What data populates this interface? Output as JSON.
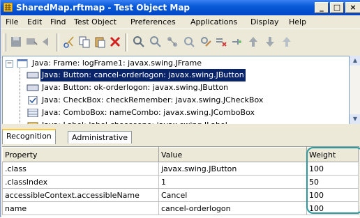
{
  "window": {
    "title": "SharedMap.rftmap - Test Object Map",
    "minimize_label": "_",
    "maximize_label": "□",
    "close_label": "×"
  },
  "menu": [
    "File",
    "Edit",
    "Find",
    "Test Object",
    "Preferences",
    "Applications",
    "Display",
    "Help"
  ],
  "tree": {
    "items": [
      {
        "label": "Java: Frame: logFrame1: javax.swing.JFrame",
        "icon": "frame-icon"
      },
      {
        "label": "Java: Button: cancel-orderlogon: javax.swing.JButton",
        "icon": "button-icon"
      },
      {
        "label": "Java: Button: ok-orderlogon: javax.swing.JButton",
        "icon": "button-icon"
      },
      {
        "label": "Java: CheckBox: checkRemember: javax.swing.JCheckBox",
        "icon": "checkbox-icon"
      },
      {
        "label": "Java: ComboBox: nameCombo: javax.swing.JComboBox",
        "icon": "combobox-icon"
      },
      {
        "label": "Java: Label: label-chooseone: javax.swing.JLabel",
        "icon": "label-icon"
      }
    ],
    "expander": "−"
  },
  "tabs": [
    "Recognition",
    "Administrative"
  ],
  "properties": {
    "columns": [
      "Property",
      "Value",
      "Weight"
    ],
    "rows": [
      {
        "property": ".class",
        "value": "javax.swing.JButton",
        "weight": "100"
      },
      {
        "property": ".classIndex",
        "value": "1",
        "weight": "50"
      },
      {
        "property": "accessibleContext.accessibleName",
        "value": "Cancel",
        "weight": "100"
      },
      {
        "property": "name",
        "value": "cancel-orderlogon",
        "weight": "100"
      }
    ]
  },
  "colors": {
    "title_bar": "#0a5ad8",
    "selection": "#0a246a",
    "highlight_ring": "#2a9a9e",
    "active_tab": "#ffc83c"
  }
}
